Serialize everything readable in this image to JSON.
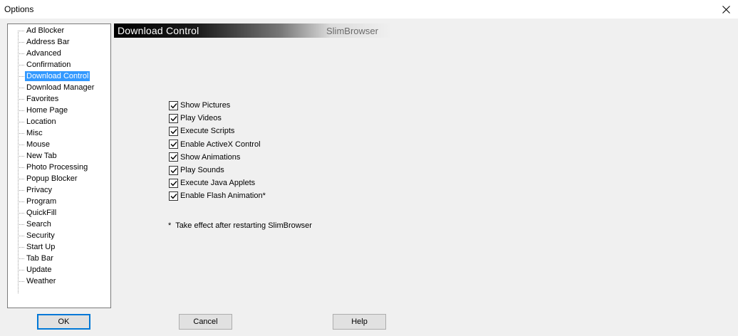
{
  "window": {
    "title": "Options"
  },
  "tree": {
    "selected_index": 4,
    "items": [
      {
        "label": "Ad Blocker"
      },
      {
        "label": "Address Bar"
      },
      {
        "label": "Advanced"
      },
      {
        "label": "Confirmation"
      },
      {
        "label": "Download Control"
      },
      {
        "label": "Download Manager"
      },
      {
        "label": "Favorites"
      },
      {
        "label": "Home Page"
      },
      {
        "label": "Location"
      },
      {
        "label": "Misc"
      },
      {
        "label": "Mouse"
      },
      {
        "label": "New Tab"
      },
      {
        "label": "Photo Processing"
      },
      {
        "label": "Popup Blocker"
      },
      {
        "label": "Privacy"
      },
      {
        "label": "Program"
      },
      {
        "label": "QuickFill"
      },
      {
        "label": "Search"
      },
      {
        "label": "Security"
      },
      {
        "label": "Start Up"
      },
      {
        "label": "Tab Bar"
      },
      {
        "label": "Update"
      },
      {
        "label": "Weather"
      }
    ]
  },
  "panel": {
    "title": "Download Control",
    "brand": "SlimBrowser",
    "options": [
      {
        "label": "Show Pictures",
        "checked": true
      },
      {
        "label": "Play Videos",
        "checked": true
      },
      {
        "label": "Execute Scripts",
        "checked": true
      },
      {
        "label": "Enable ActiveX Control",
        "checked": true
      },
      {
        "label": "Show Animations",
        "checked": true
      },
      {
        "label": "Play Sounds",
        "checked": true
      },
      {
        "label": "Execute Java Applets",
        "checked": true
      },
      {
        "label": "Enable Flash Animation*",
        "checked": true
      }
    ],
    "note": "*  Take effect after restarting SlimBrowser"
  },
  "buttons": {
    "ok": "OK",
    "cancel": "Cancel",
    "help": "Help"
  }
}
